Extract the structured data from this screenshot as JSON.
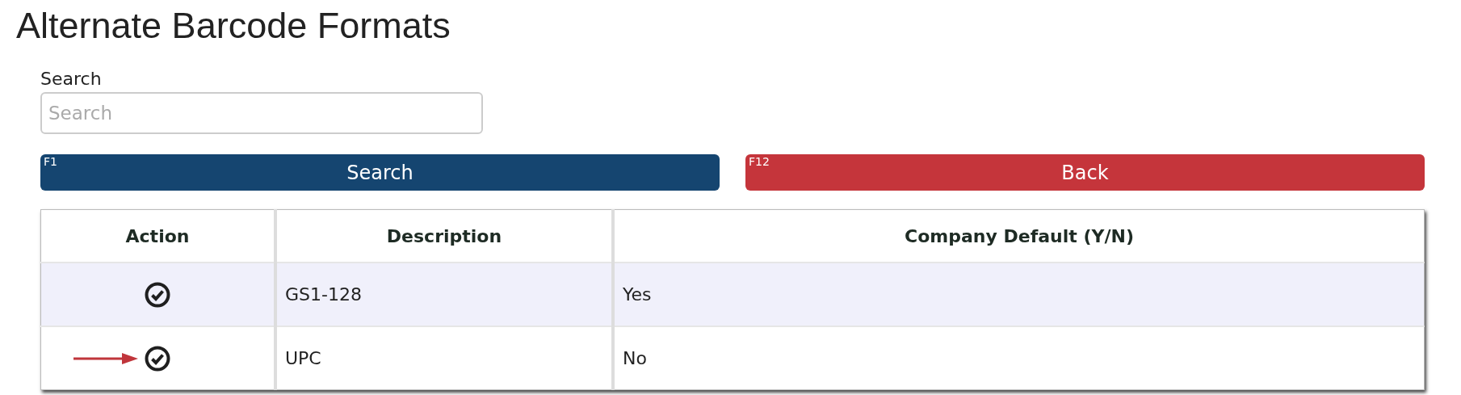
{
  "title": "Alternate Barcode Formats",
  "search": {
    "label": "Search",
    "placeholder": "Search"
  },
  "buttons": [
    {
      "key": "F1",
      "label": "Search",
      "kind": "primary"
    },
    {
      "key": "F12",
      "label": "Back",
      "kind": "danger"
    }
  ],
  "table": {
    "columns": [
      "Action",
      "Description",
      "Company Default (Y/N)"
    ],
    "rows": [
      {
        "description": "GS1-128",
        "company_default": "Yes",
        "highlighted": true,
        "pointed": false
      },
      {
        "description": "UPC",
        "company_default": "No",
        "highlighted": false,
        "pointed": true
      }
    ]
  }
}
